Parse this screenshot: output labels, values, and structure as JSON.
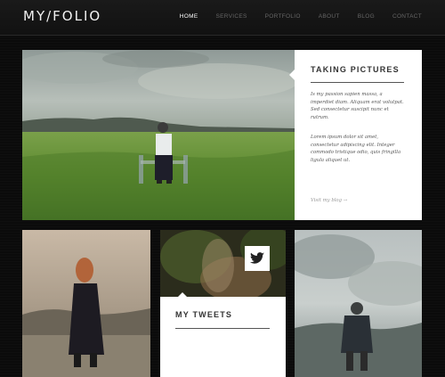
{
  "header": {
    "logo": "MY/FOLIO",
    "nav": [
      "HOME",
      "SERVICES",
      "PORTFOLIO",
      "ABOUT",
      "BLOG",
      "CONTACT"
    ]
  },
  "feature": {
    "title": "TAKING PICTURES",
    "paragraph1": "Is my passion sapien massa, a imperdiet diam. Aliquam erat volutpat. Sed consectetur suscipit nunc et rutrum.",
    "paragraph2": "Lorem ipsum dolor sit amet, consectetur adipiscing elit. Integer commodo tristique odio, quis fringilla ligula aliquet ut.",
    "link": "Visit my blog →"
  },
  "tweets": {
    "title": "MY TWEETS"
  },
  "icons": {
    "twitter": "twitter-bird-icon"
  },
  "colors": {
    "background": "#0b0b0b",
    "card": "#ffffff",
    "nav_active": "#ffffff",
    "nav_inactive": "#666666"
  }
}
